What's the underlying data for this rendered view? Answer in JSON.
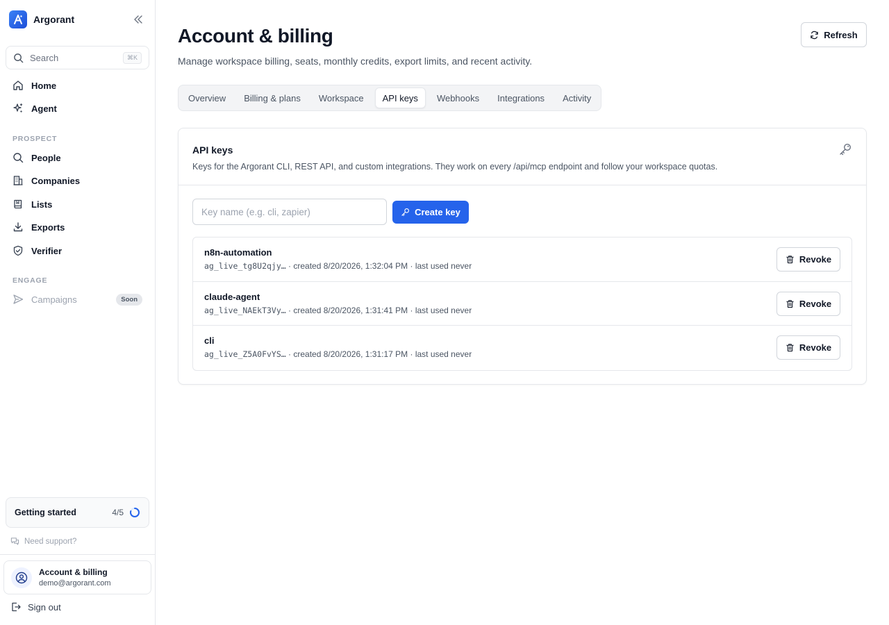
{
  "sidebar": {
    "brand": "Argorant",
    "search": {
      "label": "Search",
      "shortcut": "⌘K"
    },
    "nav_main": [
      {
        "label": "Home",
        "icon": "home-icon"
      },
      {
        "label": "Agent",
        "icon": "sparkles-icon"
      }
    ],
    "prospect_label": "PROSPECT",
    "nav_prospect": [
      {
        "label": "People",
        "icon": "search-icon"
      },
      {
        "label": "Companies",
        "icon": "building-icon"
      },
      {
        "label": "Lists",
        "icon": "book-icon"
      },
      {
        "label": "Exports",
        "icon": "download-icon"
      },
      {
        "label": "Verifier",
        "icon": "shield-check-icon"
      }
    ],
    "engage_label": "ENGAGE",
    "nav_engage": [
      {
        "label": "Campaigns",
        "icon": "send-icon",
        "badge": "Soon"
      }
    ],
    "getting_started": {
      "title": "Getting started",
      "progress": "4/5",
      "fraction": 0.8
    },
    "support": "Need support?",
    "account": {
      "name": "Account & billing",
      "email": "demo@argorant.com"
    },
    "signout": "Sign out"
  },
  "header": {
    "title": "Account & billing",
    "subtitle": "Manage workspace billing, seats, monthly credits, export limits, and recent activity.",
    "refresh_label": "Refresh"
  },
  "tabs": [
    {
      "label": "Overview",
      "active": false
    },
    {
      "label": "Billing & plans",
      "active": false
    },
    {
      "label": "Workspace",
      "active": false
    },
    {
      "label": "API keys",
      "active": true
    },
    {
      "label": "Webhooks",
      "active": false
    },
    {
      "label": "Integrations",
      "active": false
    },
    {
      "label": "Activity",
      "active": false
    }
  ],
  "api_keys": {
    "title": "API keys",
    "description": "Keys for the Argorant CLI, REST API, and custom integrations. They work on every /api/mcp endpoint and follow your workspace quotas.",
    "input_placeholder": "Key name (e.g. cli, zapier)",
    "create_label": "Create key",
    "revoke_label": "Revoke",
    "keys": [
      {
        "name": "n8n-automation",
        "token": "ag_live_tg8U2qjy…",
        "details": " · created 8/20/2026, 1:32:04 PM · last used never"
      },
      {
        "name": "claude-agent",
        "token": "ag_live_NAEkT3Vy…",
        "details": " · created 8/20/2026, 1:31:41 PM · last used never"
      },
      {
        "name": "cli",
        "token": "ag_live_Z5A0FvYS…",
        "details": " · created 8/20/2026, 1:31:17 PM · last used never"
      }
    ]
  },
  "colors": {
    "accent": "#2563eb",
    "border": "#e5e7eb",
    "muted_text": "#4b5563"
  }
}
